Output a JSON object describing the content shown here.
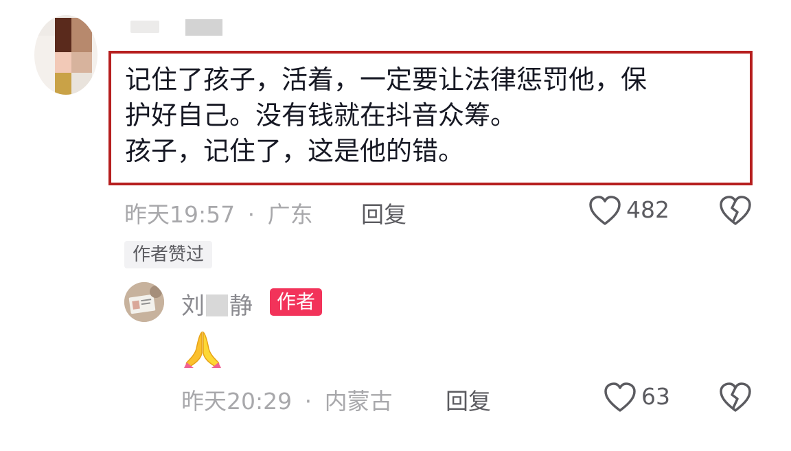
{
  "main_comment": {
    "lines": [
      "记住了孩子，活着，一定要让法律惩罚他，保",
      "护好自己。没有钱就在抖音众筹。",
      "孩子，记住了，这是他的错。"
    ],
    "time": "昨天19:57",
    "separator": "·",
    "location": "广东",
    "reply_label": "回复",
    "like_count": "482",
    "author_liked_tag": "作者赞过"
  },
  "reply_comment": {
    "author_name_first": "刘",
    "author_name_last": "静",
    "author_badge": "作者",
    "content_emoji": "pray",
    "time": "昨天20:29",
    "separator": "·",
    "location": "内蒙古",
    "reply_label": "回复",
    "like_count": "63"
  },
  "icons": {
    "like": "heart-outline-icon",
    "dislike": "broken-heart-icon"
  },
  "colors": {
    "highlight_border": "#b61e1e",
    "author_badge_bg": "#f2335a",
    "meta_text": "#a8a8ab"
  }
}
